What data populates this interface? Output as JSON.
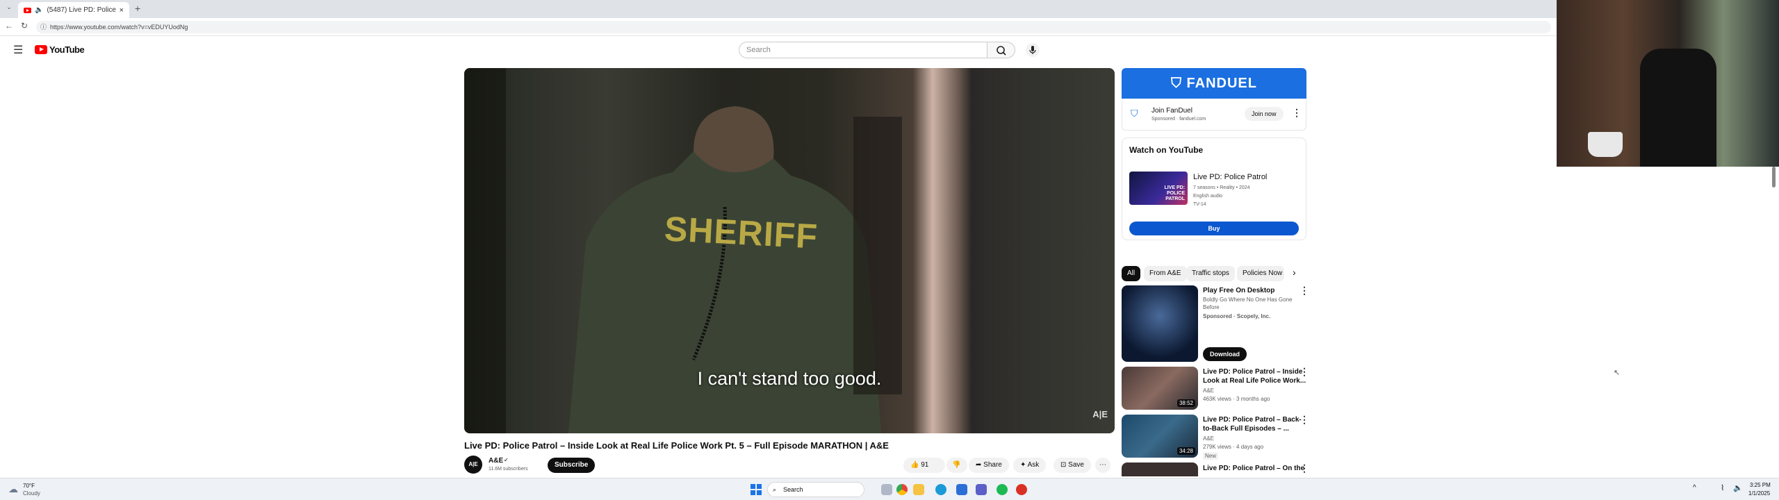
{
  "browser": {
    "tab_title": "(5487) Live PD: Police Patrol – ",
    "close_glyph": "×",
    "new_tab_glyph": "+",
    "url": "https://www.youtube.com/watch?v=vEDUYUodNg"
  },
  "header": {
    "logo_text": "YouTube",
    "search_placeholder": "Search"
  },
  "video": {
    "caption": "I can't stand too good.",
    "shirt_text": "SHERIFF",
    "watermark": "A|E",
    "title": "Live PD: Police Patrol – Inside Look at Real Life Police Work Pt. 5 – Full Episode MARATHON | A&E",
    "channel_name": "A&E",
    "channel_avatar": "A|E",
    "subscribers": "11.6M subscribers",
    "subscribe_label": "Subscribe",
    "likes": "91",
    "share_label": "Share",
    "ask_label": "Ask",
    "save_label": "Save"
  },
  "ad": {
    "brand": "FANDUEL",
    "cta_title": "Join FanDuel",
    "sponsored": "Sponsored · fanduel.com",
    "join_label": "Join now"
  },
  "watch_on": {
    "heading": "Watch on YouTube",
    "show_title": "Live PD: Police Patrol",
    "thumb_text": "LIVE PD: POLICE PATROL",
    "meta1": "7 seasons • Reality • 2024",
    "meta2": "English audio",
    "rating": "TV-14",
    "buy_label": "Buy"
  },
  "chips": [
    "All",
    "From A&E",
    "Traffic stops",
    "Policies Now"
  ],
  "recommendations": [
    {
      "title1": "Play Free On Desktop",
      "line1": "Boldly Go Where No One Has Gone",
      "line2": "Before",
      "line3": "Sponsored · Scopely, Inc.",
      "button": "Download"
    },
    {
      "title1": "Live PD: Police Patrol – Inside",
      "title2": "Look at Real Life Police Work...",
      "channel": "A&E",
      "meta": "463K views · 3 months ago",
      "duration": "38:52"
    },
    {
      "title1": "Live PD: Police Patrol – Back-",
      "title2": "to-Back Full Episodes – ...",
      "channel": "A&E",
      "meta": "279K views · 4 days ago",
      "badge": "New",
      "duration": "34:28"
    },
    {
      "title1": "Live PD: Police Patrol – On the"
    }
  ],
  "taskbar": {
    "weather_temp": "70°F",
    "weather_text": "Cloudy",
    "search_label": "Search",
    "time": "3:25 PM",
    "date": "1/1/2025"
  },
  "colors": {
    "youtube_red": "#ff0000",
    "fanduel_blue": "#1b6fe0",
    "buy_blue": "#0b57d0"
  }
}
